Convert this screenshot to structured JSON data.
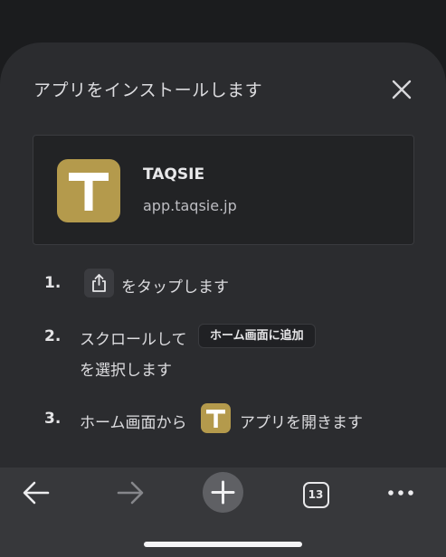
{
  "install_sheet": {
    "title": "アプリをインストールします",
    "app": {
      "name": "TAQSIE",
      "url": "app.taqsie.jp",
      "icon_letter": "T",
      "icon_color": "#b49a4c"
    },
    "steps": [
      {
        "number": "1.",
        "text_after_icon": "をタップします",
        "icon": "share-icon"
      },
      {
        "number": "2.",
        "text_before": "スクロールして",
        "chip_label": "ホーム画面に追加",
        "text_line2": "を選択します"
      },
      {
        "number": "3.",
        "text_before": "ホーム画面から",
        "text_after": "アプリを開きます"
      }
    ]
  },
  "toolbar": {
    "back_icon": "back-arrow-icon",
    "forward_icon": "forward-arrow-icon",
    "new_tab_icon": "plus-icon",
    "tab_count": "13",
    "menu_icon": "more-dots-icon"
  },
  "colors": {
    "sheet_background": "#2b2c2f",
    "toolbar_background": "#37383b",
    "accent_gold": "#b49a4c"
  }
}
